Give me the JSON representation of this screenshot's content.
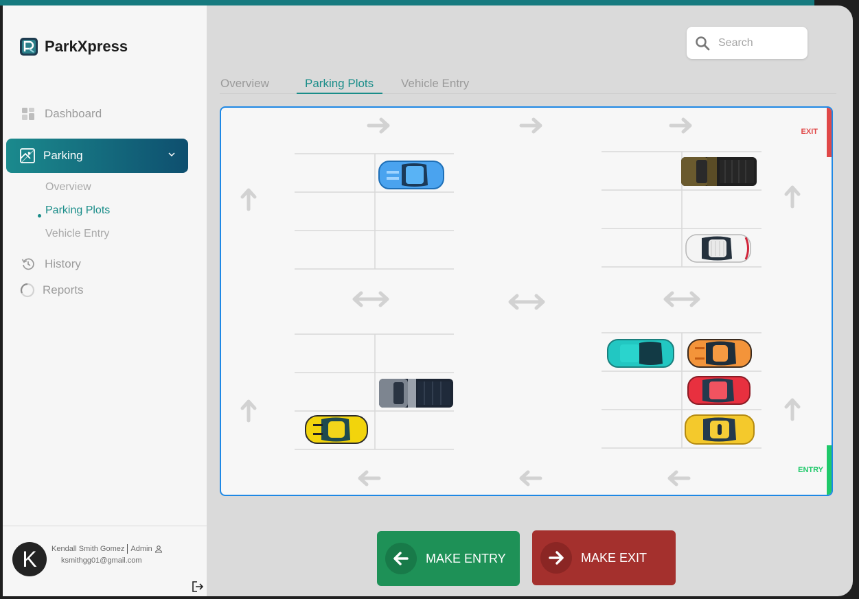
{
  "app": {
    "name": "ParkXpress"
  },
  "sidebar": {
    "items": [
      {
        "label": "Dashboard",
        "icon": "grid-icon"
      },
      {
        "label": "Parking",
        "icon": "map-icon",
        "active": true
      },
      {
        "label": "History",
        "icon": "history-icon"
      },
      {
        "label": "Reports",
        "icon": "pie-chart-icon"
      }
    ],
    "parking_submenu": [
      {
        "label": "Overview"
      },
      {
        "label": "Parking Plots",
        "active": true
      },
      {
        "label": "Vehicle Entry"
      }
    ]
  },
  "user": {
    "initial": "K",
    "name": "Kendall Smith Gomez",
    "role": "Admin",
    "email": "ksmithgg01@gmail.com"
  },
  "search": {
    "placeholder": "Search"
  },
  "tabs": [
    {
      "label": "Overview"
    },
    {
      "label": "Parking Plots",
      "active": true
    },
    {
      "label": "Vehicle Entry"
    }
  ],
  "lot": {
    "exit_label": "EXIT",
    "entry_label": "ENTRY",
    "blocks": [
      {
        "position": "top-left",
        "slots": [
          [
            "",
            "car-blue"
          ],
          [
            "",
            ""
          ],
          [
            "",
            ""
          ]
        ]
      },
      {
        "position": "top-right",
        "slots": [
          [
            "",
            "pickup-olive"
          ],
          [
            "",
            ""
          ],
          [
            "",
            "car-white"
          ]
        ]
      },
      {
        "position": "bottom-left",
        "slots": [
          [
            "",
            ""
          ],
          [
            "",
            "pickup-gray"
          ],
          [
            "car-yellow",
            ""
          ]
        ]
      },
      {
        "position": "bottom-right",
        "slots": [
          [
            "car-teal",
            "car-orange"
          ],
          [
            "",
            "car-red"
          ],
          [
            "",
            "car-yellow-gold"
          ]
        ]
      }
    ],
    "colors": {
      "border": "#1e88e5",
      "exit": "#e04848",
      "entry": "#1fc96a"
    }
  },
  "actions": {
    "entry_label": "MAKE ENTRY",
    "exit_label": "MAKE EXIT",
    "entry_color": "#1e9157",
    "exit_color": "#a4302d"
  }
}
